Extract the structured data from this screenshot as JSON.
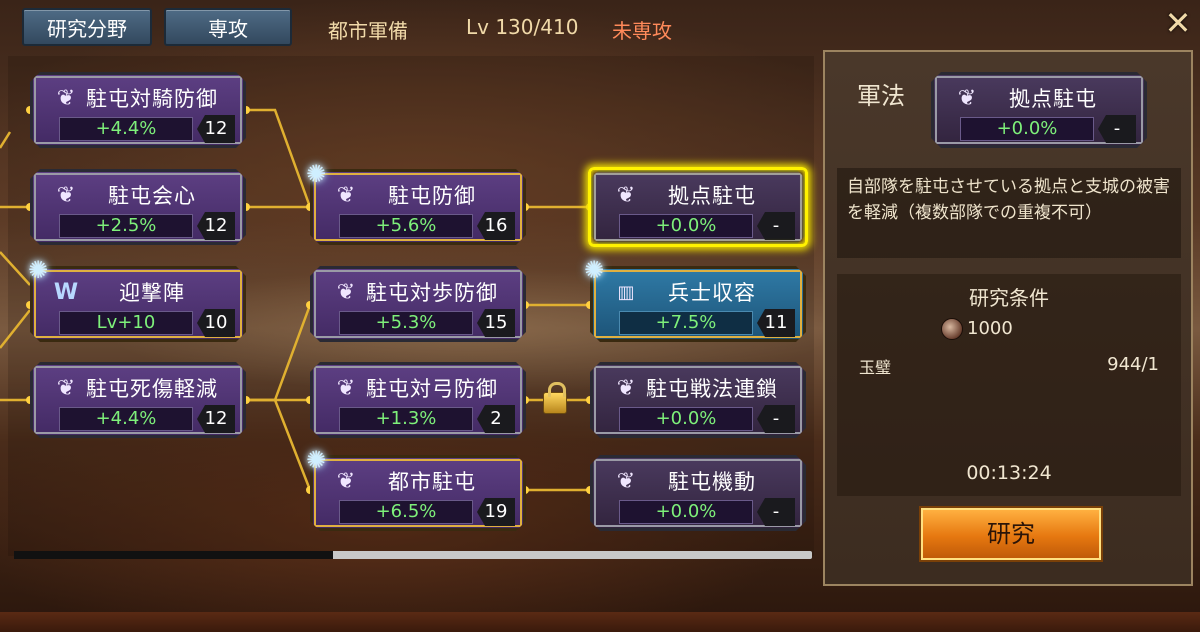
{
  "header": {
    "btn_research_field": "研究分野",
    "btn_major": "専攻",
    "city": "都市軍備",
    "level": "Lv 130/410",
    "status": "未専攻",
    "close_icon": "close-icon"
  },
  "tree": {
    "nodes": [
      {
        "id": "n1",
        "name": "駐屯対騎防御",
        "value": "+4.4%",
        "level": "12",
        "icon": "leaf-icon"
      },
      {
        "id": "n2",
        "name": "駐屯会心",
        "value": "+2.5%",
        "level": "12",
        "icon": "leaf-icon"
      },
      {
        "id": "n3",
        "name": "迎撃陣",
        "value": "Lv+10",
        "level": "10",
        "icon": "w-icon"
      },
      {
        "id": "n4",
        "name": "駐屯死傷軽減",
        "value": "+4.4%",
        "level": "12",
        "icon": "leaf-icon"
      },
      {
        "id": "n5",
        "name": "駐屯防御",
        "value": "+5.6%",
        "level": "16",
        "icon": "leaf-icon"
      },
      {
        "id": "n6",
        "name": "駐屯対歩防御",
        "value": "+5.3%",
        "level": "15",
        "icon": "leaf-icon"
      },
      {
        "id": "n7",
        "name": "駐屯対弓防御",
        "value": "+1.3%",
        "level": "2",
        "icon": "leaf-icon"
      },
      {
        "id": "n8",
        "name": "都市駐屯",
        "value": "+6.5%",
        "level": "19",
        "icon": "leaf-icon"
      },
      {
        "id": "n9",
        "name": "拠点駐屯",
        "value": "+0.0%",
        "level": "-",
        "icon": "leaf-icon"
      },
      {
        "id": "n10",
        "name": "兵士収容",
        "value": "+7.5%",
        "level": "11",
        "icon": "barracks-icon"
      },
      {
        "id": "n11",
        "name": "駐屯戦法連鎖",
        "value": "+0.0%",
        "level": "-",
        "icon": "leaf-icon"
      },
      {
        "id": "n12",
        "name": "駐屯機動",
        "value": "+0.0%",
        "level": "-",
        "icon": "leaf-icon"
      }
    ],
    "scroll_position": 0.4
  },
  "side": {
    "tactic_label": "軍法",
    "selected_name": "拠点駐屯",
    "selected_value": "+0.0%",
    "selected_level": "-",
    "description": "自部隊を駐屯させている拠点と支城の被害を軽減（複数部隊での重複不可）",
    "cond_title": "研究条件",
    "coin_amount": "1000",
    "jade_label": "玉璧",
    "jade_value": "944/1",
    "time": "00:13:24",
    "research_button": "研究"
  },
  "colors": {
    "value_green": "#7ef07a",
    "status_orange": "#ff8a5a",
    "highlight_yellow": "#fff200"
  }
}
